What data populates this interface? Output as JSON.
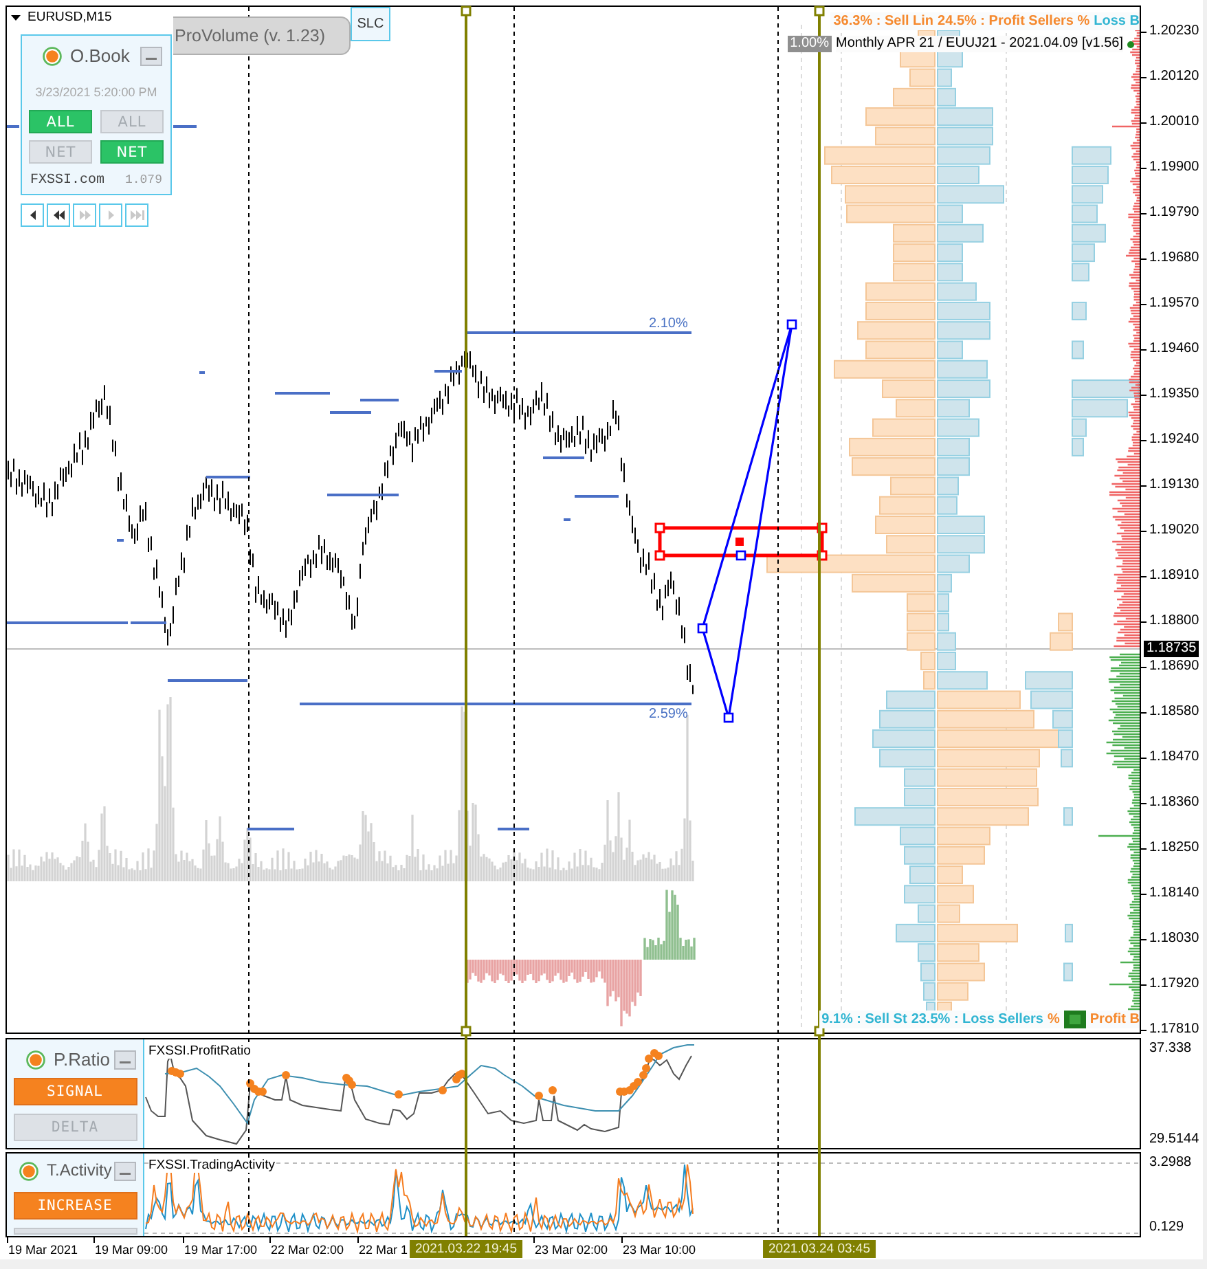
{
  "chart_header": {
    "symbol": "EURUSD,M15"
  },
  "pro_volume": {
    "title": "ProVolume (v. 1.23)",
    "slc_button": "SLC"
  },
  "order_book": {
    "title": "O.Book",
    "timestamp": "3/23/2021 5:20:00 PM",
    "toggles": [
      {
        "label": "ALL",
        "selected": true
      },
      {
        "label": "ALL",
        "selected": false
      },
      {
        "label": "NET",
        "selected": false
      },
      {
        "label": "NET",
        "selected": true
      }
    ],
    "site": "FXSSI.com",
    "version": "1.079"
  },
  "playback_buttons": [
    {
      "kind": "step-back",
      "disabled": false
    },
    {
      "kind": "rewind",
      "disabled": false
    },
    {
      "kind": "fast-forward",
      "disabled": true
    },
    {
      "kind": "step-forward",
      "disabled": true
    },
    {
      "kind": "skip-end",
      "disabled": true
    }
  ],
  "ratio_labels_top": [
    {
      "text": "36.3% : Sell Lin",
      "color": "#f5892e"
    },
    {
      "text": "24.5% : Profit Sellers %",
      "color": "#f5892e"
    },
    {
      "text": "Loss B",
      "color": "#31b5d2"
    }
  ],
  "contract_info": {
    "ratio": "1.00%",
    "text": "Monthly APR 21 / EUUJ21 - 2021.04.09 [v1.56]"
  },
  "level_labels": [
    "2.10%",
    "2.59%"
  ],
  "ratio_labels_bottom": [
    {
      "text": "9.1% : Sell St",
      "color": "#31b5d2"
    },
    {
      "text": "23.5% : Loss Sellers",
      "color": "#31b5d2"
    },
    {
      "text": "%",
      "color": "#f5892e"
    },
    {
      "text": "Profit B",
      "color": "#f5892e"
    }
  ],
  "price_axis": {
    "labels": [
      "1.20230",
      "1.20120",
      "1.20010",
      "1.19900",
      "1.19790",
      "1.19680",
      "1.19570",
      "1.19460",
      "1.19350",
      "1.19240",
      "1.19130",
      "1.19020",
      "1.18910",
      "1.18800",
      "1.18690",
      "1.18580",
      "1.18470",
      "1.18360",
      "1.18250",
      "1.18140",
      "1.18030",
      "1.17920",
      "1.17810"
    ],
    "current_price": "1.18735"
  },
  "profit_ratio": {
    "title": "P.Ratio",
    "buttons": [
      {
        "label": "SIGNAL",
        "selected": true
      },
      {
        "label": "DELTA",
        "selected": false
      }
    ],
    "indicator": "FXSSI.ProfitRatio",
    "scale": [
      "37.338",
      "29.5144"
    ]
  },
  "trading_activity": {
    "title": "T.Activity",
    "buttons": [
      {
        "label": "INCREASE",
        "selected": true
      },
      {
        "selected": false
      }
    ],
    "indicator": "FXSSI.TradingActivity",
    "scale": [
      "3.2988",
      "0.129"
    ]
  },
  "time_axis": {
    "labels": [
      "19 Mar 2021",
      "19 Mar 09:00",
      "19 Mar 17:00",
      "22 Mar 02:00",
      "22 Mar 1",
      "23 Mar 02:00",
      "23 Mar 10:00"
    ],
    "markers": [
      "2021.03.22 19:45",
      "2021.03.24 03:45"
    ]
  }
}
